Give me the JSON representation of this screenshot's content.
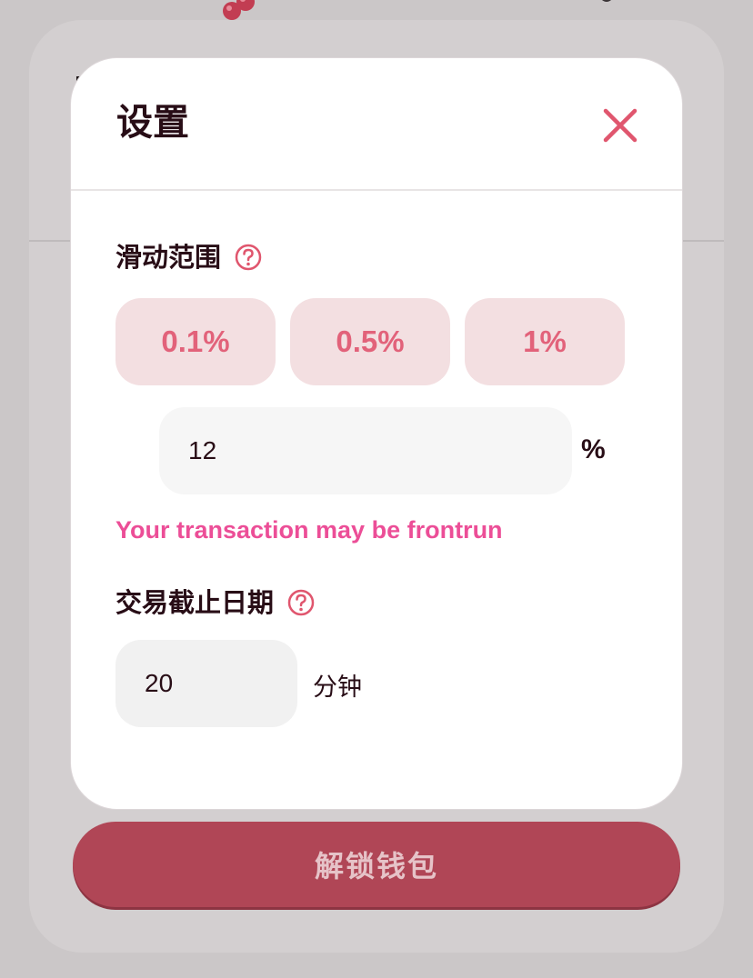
{
  "modal": {
    "title": "设置",
    "slippage": {
      "label": "滑动范围",
      "options": [
        "0.1%",
        "0.5%",
        "1%"
      ],
      "custom_value": "12",
      "unit": "%",
      "warning": "Your transaction may be frontrun"
    },
    "deadline": {
      "label": "交易截止日期",
      "value": "20",
      "unit": "分钟"
    }
  },
  "background": {
    "unlock_button_label": "解锁钱包"
  },
  "colors": {
    "accent": "#e2627a",
    "pill_bg": "#f3dfe1",
    "warning": "#ec4e97",
    "text_dark": "#280d16",
    "button_bg": "#b04656"
  },
  "icons": {
    "close": "close-icon",
    "help": "help-icon",
    "logo": "cherry-logo-icon"
  }
}
